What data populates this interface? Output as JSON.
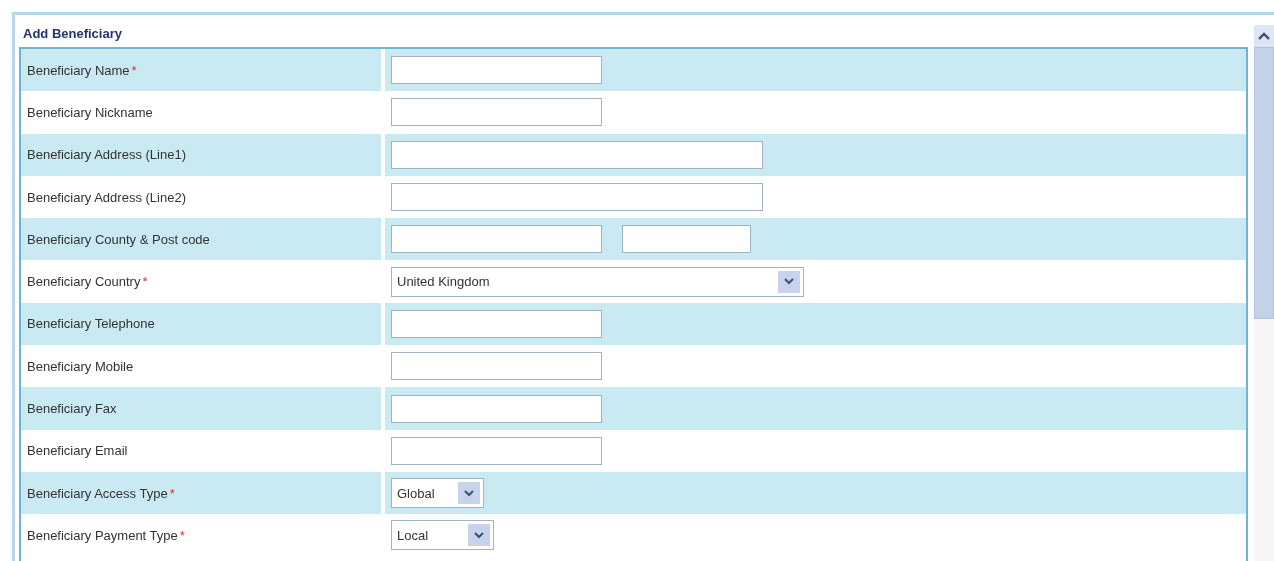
{
  "panel": {
    "title": "Add Beneficiary"
  },
  "rows": [
    {
      "label": "Beneficiary Name",
      "required_mark": "*",
      "controls": [
        {
          "kind": "input"
        }
      ]
    },
    {
      "label": "Beneficiary Nickname",
      "controls": [
        {
          "kind": "input"
        }
      ]
    },
    {
      "label": "Beneficiary Address (Line1)",
      "controls": [
        {
          "kind": "long-input"
        }
      ]
    },
    {
      "label": "Beneficiary Address (Line2)",
      "controls": [
        {
          "kind": "long-input"
        }
      ]
    },
    {
      "label": "Beneficiary County & Post code",
      "controls": [
        {
          "kind": "input"
        },
        {
          "kind": "short-input"
        }
      ]
    },
    {
      "label": "Beneficiary Country",
      "required_mark": "*",
      "controls": [
        {
          "kind": "long-select",
          "value": "United Kingdom"
        }
      ]
    },
    {
      "label": "Beneficiary Telephone",
      "controls": [
        {
          "kind": "input"
        }
      ]
    },
    {
      "label": "Beneficiary Mobile",
      "controls": [
        {
          "kind": "input"
        }
      ]
    },
    {
      "label": "Beneficiary Fax",
      "controls": [
        {
          "kind": "input"
        }
      ]
    },
    {
      "label": "Beneficiary Email",
      "controls": [
        {
          "kind": "input"
        }
      ]
    },
    {
      "label": "Beneficiary Access Type",
      "required_mark": "*",
      "controls": [
        {
          "kind": "select",
          "value": "Global"
        }
      ]
    },
    {
      "label": "Beneficiary Payment Type",
      "required_mark": "*",
      "controls": [
        {
          "kind": "select-wide",
          "value": "Local"
        }
      ]
    }
  ]
}
